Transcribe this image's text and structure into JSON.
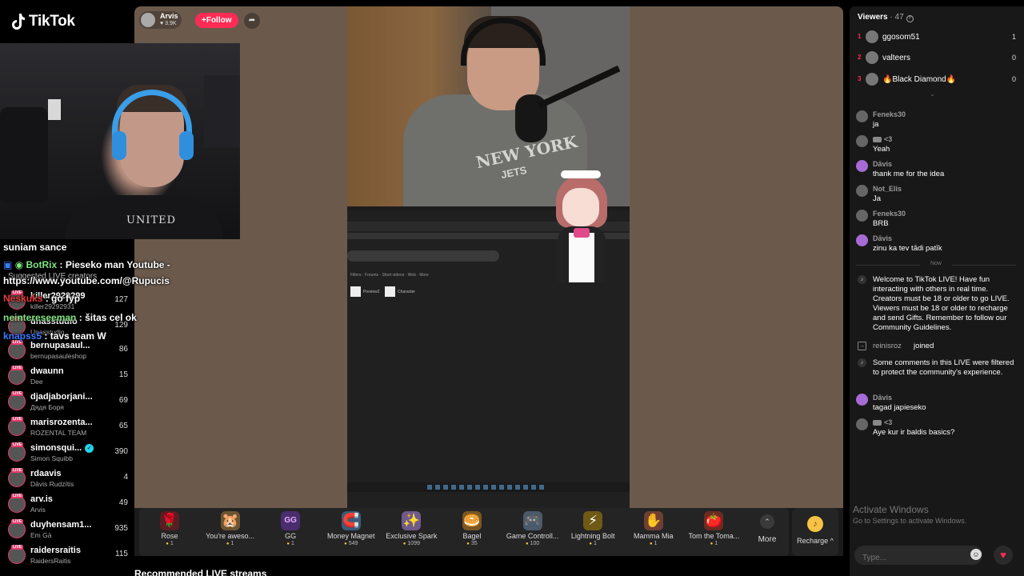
{
  "app": {
    "logo_text": "TikTok"
  },
  "host": {
    "name": "Arvis",
    "likes": "3.9K",
    "follow_label": "+Follow"
  },
  "overlay_chat": [
    {
      "name": "",
      "text": "suniam sance"
    },
    {
      "name": "BotRix",
      "text": ": Pieseko man Youtube -"
    },
    {
      "name": "",
      "text": "https://www.youtube.com/@Rupucis"
    },
    {
      "name": "Neskuks",
      "text": ": go fyp"
    },
    {
      "name": "neintereseeman",
      "text": ": šitas cel ok"
    },
    {
      "name": "knapss5",
      "text": ": tavs team W"
    }
  ],
  "suggested": {
    "title": "Suggested LIVE creators",
    "items": [
      {
        "name": "killer2929299",
        "sub": "killer29292931",
        "count": "127"
      },
      {
        "name": "unasstudio",
        "sub": "Unasstudio",
        "count": "129"
      },
      {
        "name": "bernupasaul...",
        "sub": "bernupasauleshop",
        "count": "86"
      },
      {
        "name": "dwaunn",
        "sub": "Dee",
        "count": "15"
      },
      {
        "name": "djadjaborjani...",
        "sub": "Дядя Боря",
        "count": "69"
      },
      {
        "name": "marisrozenta...",
        "sub": "ROZENTAL TEAM",
        "count": "65"
      },
      {
        "name": "simonsqui...",
        "sub": "Simon Squibb",
        "count": "390"
      },
      {
        "name": "rdaavis",
        "sub": "Dāvis Rudzītis",
        "count": "4"
      },
      {
        "name": "arv.is",
        "sub": "Arvis",
        "count": "49"
      },
      {
        "name": "duyhensam1...",
        "sub": "Em Gà",
        "count": "935"
      },
      {
        "name": "raidersraitis",
        "sub": "RaidersRaitis",
        "count": "115"
      }
    ]
  },
  "stream": {
    "shirt_text": "UNITED",
    "cam2_logo": "NEW YORK",
    "cam2_logo_sub": "JETS",
    "screen_labels": [
      "Preview2",
      "Character"
    ]
  },
  "gifts": [
    {
      "icon": "rose-icon",
      "glyph": "🌹",
      "name": "Rose",
      "price": "1"
    },
    {
      "icon": "pet-icon",
      "glyph": "🐹",
      "name": "You're aweso...",
      "price": "1"
    },
    {
      "icon": "gg-icon",
      "glyph": "GG",
      "name": "GG",
      "price": "1"
    },
    {
      "icon": "magnet-icon",
      "glyph": "🧲",
      "name": "Money Magnet",
      "price": "549"
    },
    {
      "icon": "spark-icon",
      "glyph": "✨",
      "name": "Exclusive Spark",
      "price": "1099"
    },
    {
      "icon": "bagel-icon",
      "glyph": "🥯",
      "name": "Bagel",
      "price": "35"
    },
    {
      "icon": "controller-icon",
      "glyph": "🎮",
      "name": "Game Controll...",
      "price": "100"
    },
    {
      "icon": "lightning-icon",
      "glyph": "⚡",
      "name": "Lightning Bolt",
      "price": "1"
    },
    {
      "icon": "hand-icon",
      "glyph": "✋",
      "name": "Mamma Mia",
      "price": "1"
    },
    {
      "icon": "tomato-icon",
      "glyph": "🍅",
      "name": "Tom the Toma...",
      "price": "1"
    }
  ],
  "gift_more_label": "More",
  "recharge_label": "Recharge ^",
  "recommended_title": "Recommended LIVE streams",
  "viewers": {
    "title": "Viewers",
    "count": "· 47",
    "list": [
      {
        "rank": "1",
        "name": "ggosom51",
        "score": "1"
      },
      {
        "rank": "2",
        "name": "valteers",
        "score": "0"
      },
      {
        "rank": "3",
        "name": "🔥Black Diamond🔥",
        "score": "0"
      }
    ]
  },
  "chat": [
    {
      "name": "Feneks30",
      "text": "ja"
    },
    {
      "name": "<3",
      "text": "Yeah"
    },
    {
      "name": "Dāvis",
      "text": "thank me for the idea"
    },
    {
      "name": "Not_Elis",
      "text": "Ja"
    },
    {
      "name": "Feneks30",
      "text": "BRB"
    },
    {
      "name": "Dāvis",
      "text": "zinu ka tev tādi patīk"
    }
  ],
  "now_label": "Now",
  "system_welcome": "Welcome to TikTok LIVE! Have fun interacting with others in real time. Creators must be 18 or older to go LIVE. Viewers must be 18 or older to recharge and send Gifts. Remember to follow our Community Guidelines.",
  "joined": {
    "name": "reinisroz",
    "text": "joined"
  },
  "system_filtered": "Some comments in this LIVE were filtered to protect the community's experience.",
  "chat_after": [
    {
      "name": "Dāvis",
      "text": "tagad japieseko"
    },
    {
      "name": "<3",
      "text": "Aye kur ir baldis basics?"
    }
  ],
  "activate": {
    "title": "Activate Windows",
    "sub": "Go to Settings to activate Windows."
  },
  "input": {
    "placeholder": "Type..."
  }
}
